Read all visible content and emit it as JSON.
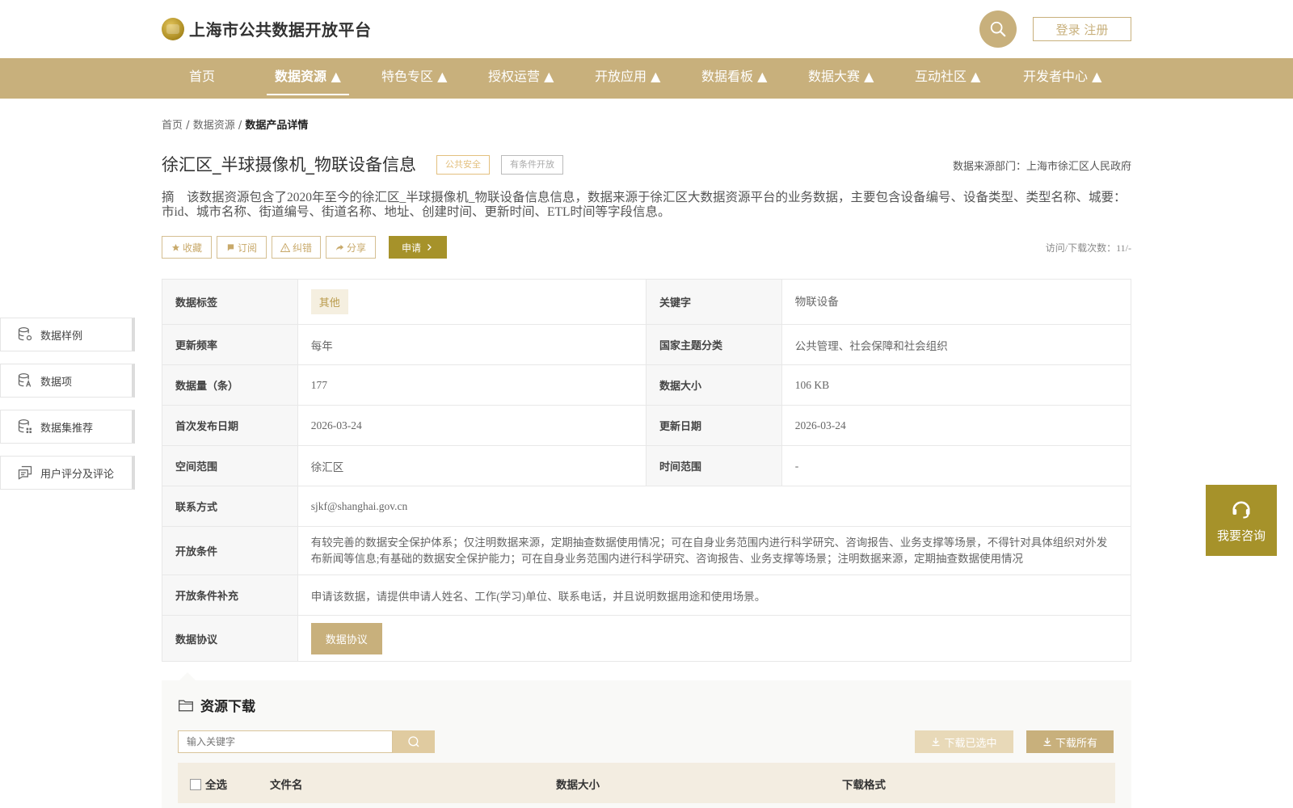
{
  "header": {
    "site_title": "上海市公共数据开放平台",
    "login_label": "登录 注册"
  },
  "nav": {
    "items": [
      {
        "label": "首页"
      },
      {
        "label": "数据资源 ▲"
      },
      {
        "label": "特色专区 ▲"
      },
      {
        "label": "授权运营 ▲"
      },
      {
        "label": "开放应用 ▲"
      },
      {
        "label": "数据看板 ▲"
      },
      {
        "label": "数据大赛 ▲"
      },
      {
        "label": "互动社区 ▲"
      },
      {
        "label": "开发者中心 ▲"
      }
    ],
    "active_index": 1
  },
  "breadcrumb": {
    "home": "首页",
    "sep": "/",
    "section": "数据资源",
    "current": "数据产品详情"
  },
  "dataset": {
    "title": "徐汇区_半球摄像机_物联设备信息",
    "tag_topic": "公共安全",
    "tag_open": "有条件开放",
    "source_dept": "数据来源部门：上海市徐汇区人民政府",
    "abstract": "摘　该数据资源包含了2020年至今的徐汇区_半球摄像机_物联设备信息信息，数据来源于徐汇区大数据资源平台的业务数据，主要包含设备编号、设备类型、类型名称、城要：市id、城市名称、街道编号、街道名称、地址、创建时间、更新时间、ETL时间等字段信息。",
    "visits": "访问/下载次数：11/-"
  },
  "actions": {
    "favorite": "收藏",
    "subscribe": "订阅",
    "report": "纠错",
    "share": "分享",
    "apply": "申请"
  },
  "info": {
    "tags_label": "数据标签",
    "tags_value": "其他",
    "keyword_label": "关键字",
    "keyword_value": "物联设备",
    "freq_label": "更新频率",
    "freq_value": "每年",
    "theme_label": "国家主题分类",
    "theme_value": "公共管理、社会保障和社会组织",
    "count_label": "数据量（条）",
    "count_value": "177",
    "size_label": "数据大小",
    "size_value": "106 KB",
    "first_pub_label": "首次发布日期",
    "first_pub_value": "2026-03-24",
    "update_label": "更新日期",
    "update_value": "2026-03-24",
    "space_label": "空间范围",
    "space_value": "徐汇区",
    "time_label": "时间范围",
    "time_value": "-",
    "contact_label": "联系方式",
    "contact_value": "sjkf@shanghai.gov.cn",
    "cond_label": "开放条件",
    "cond_value": "有较完善的数据安全保护体系；仅注明数据来源，定期抽查数据使用情况；可在自身业务范围内进行科学研究、咨询报告、业务支撑等场景，不得针对具体组织对外发布新闻等信息;有基础的数据安全保护能力；可在自身业务范围内进行科学研究、咨询报告、业务支撑等场景；注明数据来源，定期抽查数据使用情况",
    "cond_extra_label": "开放条件补充",
    "cond_extra_value": "申请该数据，请提供申请人姓名、工作(学习)单位、联系电话，并且说明数据用途和使用场景。",
    "agreement_label": "数据协议",
    "agreement_button": "数据协议"
  },
  "side_menu": [
    {
      "label": "数据样例",
      "icon": "database-gear-icon"
    },
    {
      "label": "数据项",
      "icon": "database-text-icon"
    },
    {
      "label": "数据集推荐",
      "icon": "database-grid-icon"
    },
    {
      "label": "用户评分及评论",
      "icon": "comment-icon"
    }
  ],
  "consult": {
    "label": "我要咨询",
    "icon": "headset-icon"
  },
  "download": {
    "title": "资源下载",
    "search_placeholder": "输入关键字",
    "download_selected": "下载已选中",
    "download_all": "下载所有",
    "columns": {
      "select_all": "全选",
      "file_name": "文件名",
      "data_size": "数据大小",
      "format": "下载格式"
    }
  },
  "colors": {
    "brand": "#c8b07c",
    "accent_dark": "#a6922a",
    "tag_topic": "#e3c07f"
  }
}
